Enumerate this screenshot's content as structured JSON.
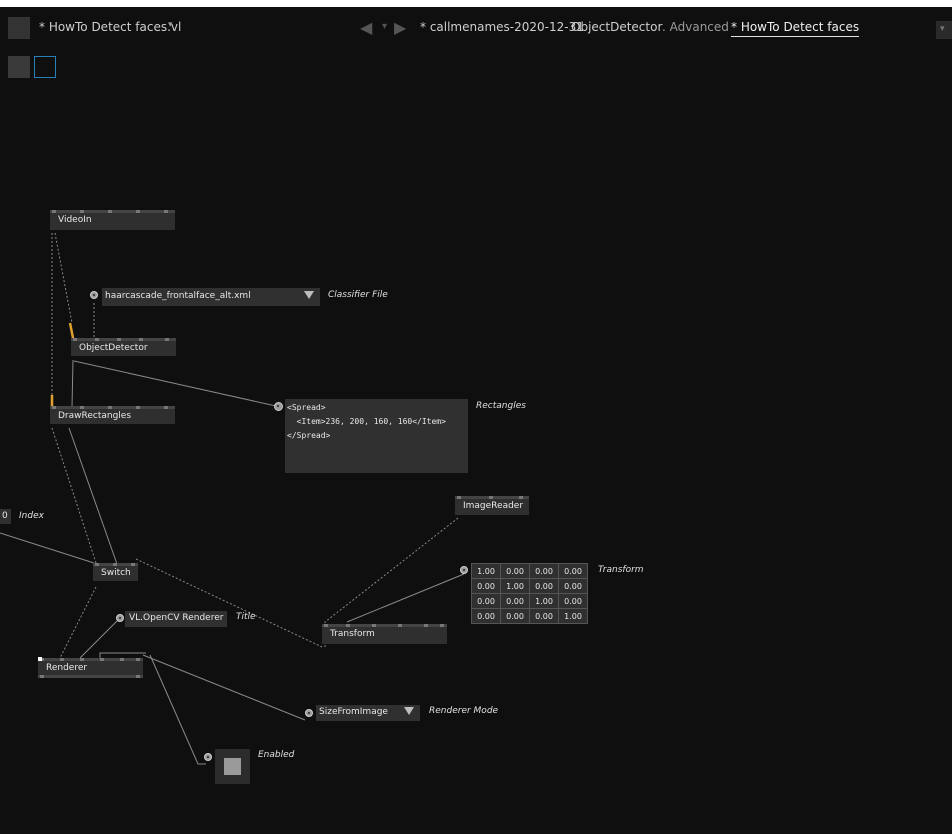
{
  "toolbar": {
    "document_title": "* HowTo Detect faces.vl",
    "dropdown_glyph": "▾",
    "nav_back": "◀",
    "nav_menu": "▾",
    "nav_forward": "▶",
    "tabs": [
      {
        "label": "* callmenames-2020-12-31",
        "active": false
      },
      {
        "label": "ObjectDetector",
        "active": false
      },
      {
        "label": ". Advanced",
        "active": false
      },
      {
        "label": "* HowTo Detect faces",
        "active": true
      }
    ],
    "corner_glyph": "▾"
  },
  "nodes": {
    "videoin": "VideoIn",
    "object_detector": "ObjectDetector",
    "draw_rectangles": "DrawRectangles",
    "image_reader": "ImageReader",
    "switch": "Switch",
    "transform": "Transform",
    "renderer": "Renderer"
  },
  "inputs": {
    "classifier_file": {
      "value": "haarcascade_frontalface_alt.xml",
      "caption": "Classifier File"
    },
    "index": {
      "value": "0",
      "caption": "Index"
    },
    "title": {
      "value": "VL.OpenCV Renderer",
      "caption": "Title"
    },
    "renderer_mode": {
      "value": "SizeFromImage",
      "caption": "Renderer Mode"
    },
    "enabled": {
      "caption": "Enabled",
      "checked": false
    }
  },
  "outputs": {
    "rectangles": {
      "caption": "Rectangles",
      "lines": [
        "<Spread>",
        "  <Item>236, 200, 160, 160</Item>",
        "</Spread>"
      ]
    }
  },
  "transform_matrix": {
    "caption": "Transform",
    "rows": [
      [
        "1.00",
        "0.00",
        "0.00",
        "0.00"
      ],
      [
        "0.00",
        "1.00",
        "0.00",
        "0.00"
      ],
      [
        "0.00",
        "0.00",
        "1.00",
        "0.00"
      ],
      [
        "0.00",
        "0.00",
        "0.00",
        "1.00"
      ]
    ]
  },
  "colors": {
    "background": "#0f0f0f",
    "node": "#2f2f2f",
    "link": "#8a8a8a",
    "active_link": "#e0a030",
    "accent": "#2a7fb5"
  }
}
